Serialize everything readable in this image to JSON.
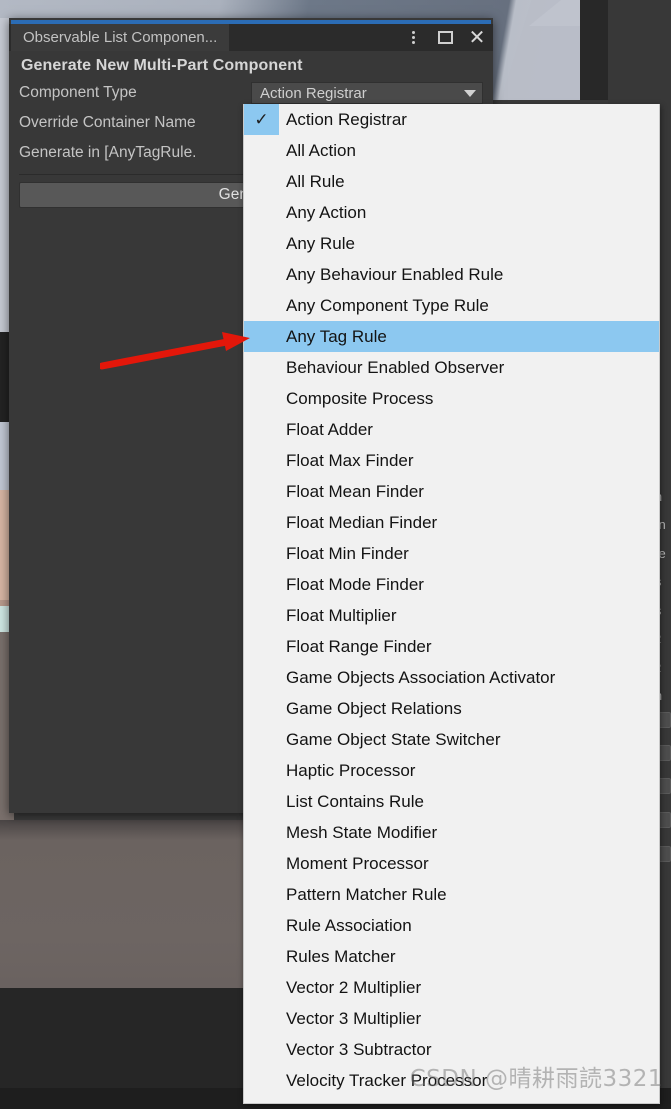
{
  "window": {
    "tab_title": "Observable List Componen...",
    "form_title": "Generate New Multi-Part Component",
    "controls": {
      "menu": "kebab-menu-icon",
      "maximize": "maximize-icon",
      "close": "close-icon"
    },
    "rows": [
      {
        "label": "Component Type",
        "value": "Action Registrar",
        "kind": "popup"
      },
      {
        "label": "Override Container Name",
        "value": "",
        "kind": "text"
      },
      {
        "label": "Generate in [AnyTagRule.",
        "value": "",
        "kind": "text"
      }
    ],
    "generate_button": "Generate"
  },
  "dropdown": {
    "selected": "Action Registrar",
    "highlighted": "Any Tag Rule",
    "check_glyph": "✓",
    "items": [
      "Action Registrar",
      "All Action",
      "All Rule",
      "Any Action",
      "Any Rule",
      "Any Behaviour Enabled Rule",
      "Any Component Type Rule",
      "Any Tag Rule",
      "Behaviour Enabled Observer",
      "Composite Process",
      "Float Adder",
      "Float Max Finder",
      "Float Mean Finder",
      "Float Median Finder",
      "Float Min Finder",
      "Float Mode Finder",
      "Float Multiplier",
      "Float Range Finder",
      "Game Objects Association Activator",
      "Game Object Relations",
      "Game Object State Switcher",
      "Haptic Processor",
      "List Contains Rule",
      "Mesh State Modifier",
      "Moment Processor",
      "Pattern Matcher Rule",
      "Rule Association",
      "Rules Matcher",
      "Vector 2 Multiplier",
      "Vector 3 Multiplier",
      "Vector 3 Subtractor",
      "Velocity Tracker Processor"
    ]
  },
  "annotation": {
    "arrow_color": "#e3170a",
    "arrow_name": "red-pointer-arrow"
  },
  "background": {
    "right_panel_text": [
      "·",
      "ir",
      "ir",
      "ir",
      "ir",
      "in",
      "Jn",
      "Te",
      "is",
      "is",
      "R",
      "R",
      "in"
    ],
    "left_swatches": [
      "#c2c8d4",
      "#d6b6a4",
      "#cfe7e3",
      "#7a706c"
    ]
  },
  "watermark": "CSDN @晴耕雨読3321",
  "colors": {
    "accent_blue": "#2b6cb5",
    "highlight_blue": "#8cc8f0",
    "window_bg": "#383838",
    "popup_bg": "#f1f1f1"
  }
}
